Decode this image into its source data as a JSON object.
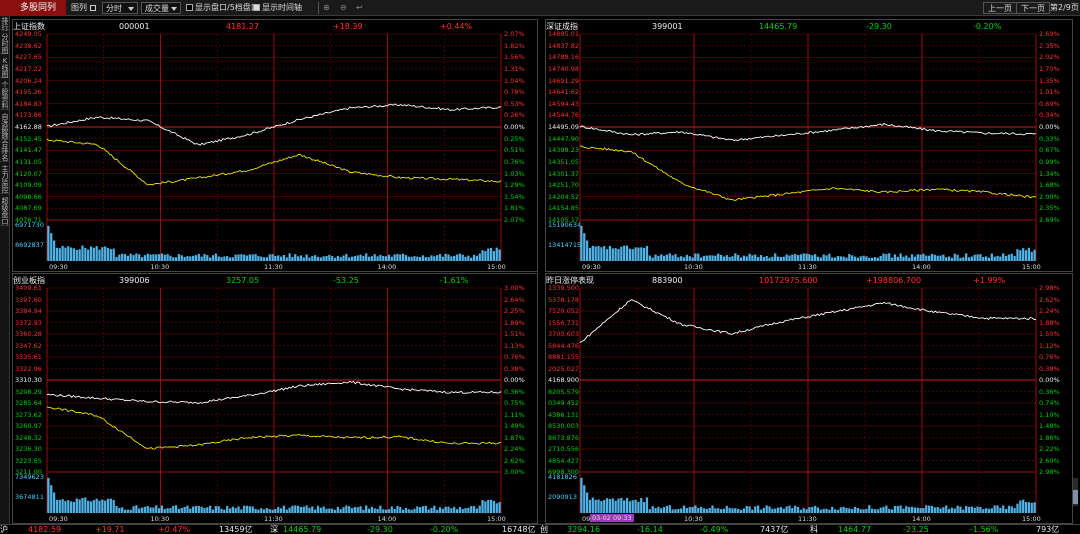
{
  "toolbar": {
    "active_tab": "多股同列",
    "layout_label": "图列",
    "period": "分时",
    "indicator": "成交量",
    "opt_orderbook": "显示盘口/5档盘口",
    "opt_timeaxis": "显示时间轴",
    "prev_page": "上一页",
    "next_page": "下一页",
    "page_indicator": "第2/9页"
  },
  "sidebar": [
    "排行",
    "分时图",
    "K线图",
    "个股资料",
    "自选股",
    "综合排名",
    "主力监控",
    "超级盘口"
  ],
  "x_ticks": [
    "09:30",
    "10:30",
    "11:30",
    "14:00",
    "15:00"
  ],
  "colors": {
    "up": "#ff3030",
    "down": "#00d000",
    "price_line": "#ffffff",
    "avg_line": "#e8e800",
    "grid": "#8a0000",
    "volume": "#4fb3e8"
  },
  "panels": [
    {
      "name": "上证指数",
      "code": "000001",
      "price": "4181.27",
      "change": "+18.39",
      "pct": "+0.44%",
      "dir": "up",
      "left_ticks": [
        "4249.05",
        "4238.62",
        "4227.65",
        "4217.22",
        "4206.24",
        "4195.26",
        "4184.83",
        "4173.86",
        "4162.88",
        "4152.45",
        "4141.47",
        "4131.05",
        "4120.07",
        "4109.09",
        "4098.66",
        "4087.69",
        "4076.71"
      ],
      "right_ticks": [
        "2.07%",
        "1.82%",
        "1.56%",
        "1.31%",
        "1.04%",
        "0.78%",
        "0.53%",
        "0.26%",
        "0.00%",
        "0.25%",
        "0.51%",
        "0.76%",
        "1.03%",
        "1.29%",
        "1.54%",
        "1.81%",
        "2.07%"
      ],
      "vol_labels": [
        "6971730",
        "8692837"
      ]
    },
    {
      "name": "深证成指",
      "code": "399001",
      "price": "14465.79",
      "change": "-29.30",
      "pct": "-0.20%",
      "dir": "down",
      "left_ticks": [
        "14885.01",
        "14837.82",
        "14788.16",
        "14740.98",
        "14691.29",
        "14641.62",
        "14594.43",
        "14544.76",
        "14495.09",
        "14447.90",
        "14398.23",
        "14351.05",
        "14301.37",
        "14251.70",
        "14204.52",
        "14154.85",
        "14105.17"
      ],
      "right_ticks": [
        "2.69%",
        "2.35%",
        "2.02%",
        "1.70%",
        "1.35%",
        "1.01%",
        "0.69%",
        "0.34%",
        "0.00%",
        "0.33%",
        "0.67%",
        "0.99%",
        "1.34%",
        "1.68%",
        "2.00%",
        "2.35%",
        "2.69%"
      ],
      "vol_labels": [
        "15190634",
        "13414715"
      ]
    },
    {
      "name": "创业板指",
      "code": "399006",
      "price": "3257.05",
      "change": "-53.25",
      "pct": "-1.61%",
      "dir": "down",
      "left_ticks": [
        "3409.61",
        "3397.60",
        "3384.94",
        "3372.93",
        "3360.28",
        "3347.62",
        "3335.61",
        "3322.96",
        "3310.30",
        "3298.29",
        "3285.64",
        "3273.62",
        "3260.97",
        "3248.32",
        "3236.30",
        "3223.65",
        "3211.00"
      ],
      "right_ticks": [
        "3.00%",
        "2.64%",
        "2.25%",
        "1.89%",
        "1.51%",
        "1.13%",
        "0.76%",
        "0.38%",
        "0.00%",
        "0.36%",
        "0.75%",
        "1.11%",
        "1.49%",
        "1.87%",
        "2.24%",
        "2.62%",
        "3.00%"
      ],
      "vol_labels": [
        "7349623",
        "3674811"
      ]
    },
    {
      "name": "昨日涨停表现",
      "code": "883900",
      "price": "10172975.600",
      "change": "+198806.700",
      "pct": "+1.99%",
      "dir": "up",
      "left_ticks": [
        "1339.500",
        "5378.178",
        "7520.052",
        "1556.731",
        "3700.603",
        "5844.476",
        "8881.155",
        "2025.027",
        "4168.900",
        "8205.579",
        "0349.452",
        "4386.131",
        "8530.003",
        "8673.876",
        "2710.556",
        "4854.427",
        "6998.300"
      ],
      "right_ticks": [
        "2.98%",
        "2.62%",
        "2.24%",
        "1.88%",
        "1.50%",
        "1.12%",
        "0.76%",
        "0.38%",
        "0.00%",
        "0.36%",
        "0.74%",
        "1.10%",
        "1.48%",
        "1.86%",
        "2.22%",
        "2.60%",
        "2.98%"
      ],
      "vol_labels": [
        "4181826",
        "2090913"
      ],
      "cursor_time": "03-02 09:33"
    }
  ],
  "chart_data": [
    {
      "type": "line",
      "title": "上证指数",
      "x": [
        "09:30",
        "10:30",
        "11:30",
        "14:00",
        "15:00"
      ],
      "ylim": [
        4076.71,
        4249.05
      ],
      "series": [
        {
          "name": "price",
          "values": [
            4163.4,
            4172.1,
            4168.6,
            4146.2,
            4156.1,
            4169.8,
            4180.5,
            4183.6,
            4178.9,
            4181.3
          ]
        },
        {
          "name": "avg",
          "values": [
            4151.0,
            4146.7,
            4109.4,
            4115.6,
            4123.2,
            4137.4,
            4121.4,
            4115.9,
            4114.5,
            4112.4
          ]
        }
      ]
    },
    {
      "type": "line",
      "title": "深证成指",
      "x": [
        "09:30",
        "10:30",
        "11:30",
        "14:00",
        "15:00"
      ],
      "ylim": [
        14105.17,
        14885.01
      ],
      "series": [
        {
          "name": "price",
          "values": [
            14497.9,
            14462.8,
            14474.6,
            14439.6,
            14460.3,
            14481.9,
            14506.4,
            14479.8,
            14469.3,
            14465.8
          ]
        },
        {
          "name": "avg",
          "values": [
            14413.0,
            14392.8,
            14259.6,
            14188.7,
            14213.4,
            14238.8,
            14221.7,
            14234.8,
            14221.9,
            14198.8
          ]
        }
      ]
    },
    {
      "type": "line",
      "title": "创业板指",
      "x": [
        "09:30",
        "10:30",
        "11:30",
        "14:00",
        "15:00"
      ],
      "ylim": [
        3211.0,
        3409.61
      ],
      "series": [
        {
          "name": "price",
          "values": [
            3294.7,
            3290.6,
            3287.0,
            3285.9,
            3293.6,
            3303.8,
            3308.2,
            3300.5,
            3297.0,
            3297.0
          ]
        },
        {
          "name": "avg",
          "values": [
            3281.4,
            3271.7,
            3236.1,
            3240.1,
            3248.3,
            3250.6,
            3247.9,
            3248.9,
            3241.6,
            3242.4
          ]
        }
      ]
    },
    {
      "type": "line",
      "title": "昨日涨停表现",
      "x": [
        "09:30",
        "10:30",
        "11:30",
        "14:00",
        "15:00"
      ],
      "ylim": [
        -0.0298,
        0.0298
      ],
      "series": [
        {
          "name": "price",
          "values": [
            0.012,
            0.026,
            0.018,
            0.015,
            0.019,
            0.022,
            0.025,
            0.022,
            0.02,
            0.0199
          ]
        }
      ]
    }
  ],
  "status": [
    {
      "mk": "沪",
      "price": "4182.59",
      "chg": "+19.71",
      "pct": "+0.47%",
      "amt": "13459亿",
      "dir": "up"
    },
    {
      "mk": "深",
      "price": "14465.79",
      "chg": "-29.30",
      "pct": "-0.20%",
      "amt": "16748亿",
      "dir": "down"
    },
    {
      "mk": "创",
      "price": "3294.16",
      "chg": "-16.14",
      "pct": "-0.49%",
      "amt": "7437亿",
      "dir": "down"
    },
    {
      "mk": "科",
      "price": "1464.77",
      "chg": "-23.25",
      "pct": "-1.56%",
      "amt": "793亿",
      "dir": "down"
    }
  ]
}
